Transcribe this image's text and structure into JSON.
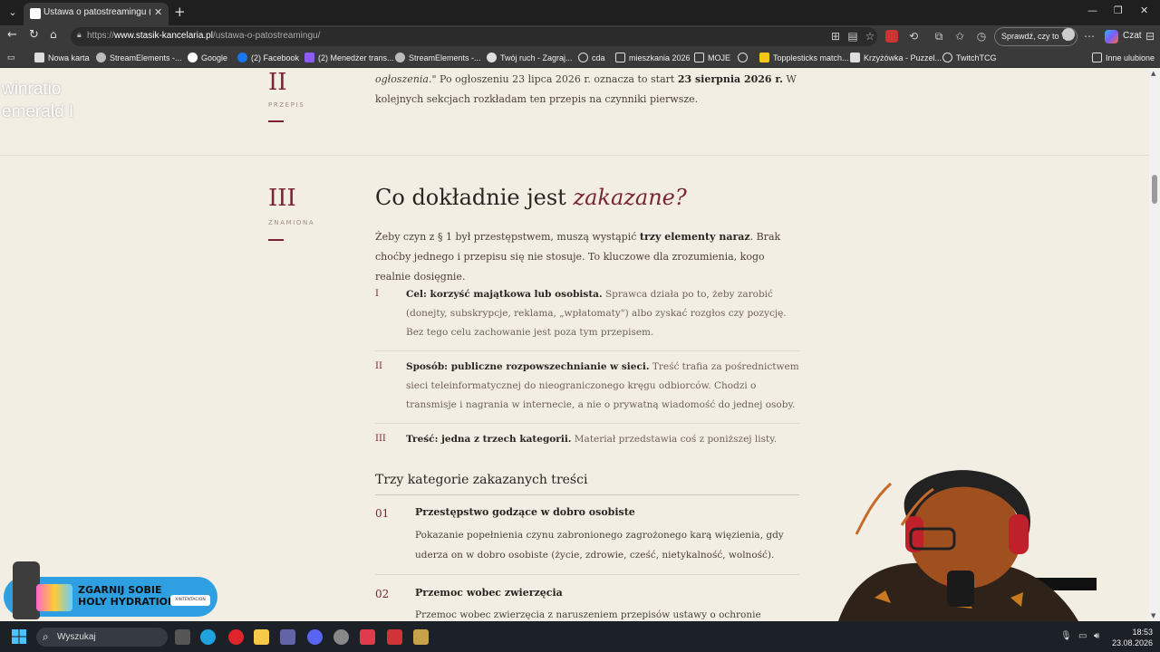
{
  "browser": {
    "tab_title": "Ustawa o patostreamingu (art. 25",
    "url_prefix": "https://",
    "url_domain": "www.stasik-kancelaria.pl",
    "url_path": "/ustawa-o-patostreamingu/",
    "check_button": "Sprawdź, czy to Ty",
    "copilot_label": "Czat"
  },
  "bookmarks": [
    "Nowa karta",
    "StreamElements -...",
    "Google",
    "(2) Facebook",
    "(2) Menedżer trans...",
    "StreamElements -...",
    "Twój ruch - Zagraj...",
    "cda",
    "mieszkania 2026",
    "MOJE",
    "",
    "Topplesticks match...",
    "Krzyżówka - Puzzel...",
    "TwitchTCG"
  ],
  "bookmarks_other": "Inne ulubione",
  "overlay_text": "winratio\nemerald I",
  "section2": {
    "numeral": "II",
    "label": "PRZEPIS",
    "para_em": "ogłoszenia.\"",
    "para_a": " Po ogłoszeniu 23 lipca 2026 r. oznacza to start ",
    "para_b": "23 sierpnia 2026 r.",
    "para_c": " W kolejnych sekcjach rozkładam ten przepis na czynniki pierwsze."
  },
  "section3": {
    "numeral": "III",
    "label": "ZNAMIONA",
    "heading_a": "Co dokładnie jest ",
    "heading_em": "zakazane?",
    "intro_a": "Żeby czyn z § 1 był przestępstwem, muszą wystąpić ",
    "intro_b": "trzy elementy naraz",
    "intro_c": ". Brak choćby jednego i przepisu się nie stosuje. To kluczowe dla zrozumienia, kogo realnie dosięgnie.",
    "requirements": [
      {
        "num": "I",
        "title": "Cel: korzyść majątkowa lub osobista.",
        "text": " Sprawca działa po to, żeby zarobić (donejty, subskrypcje, reklama, „wpłatomaty\") albo zyskać rozgłos czy pozycję. Bez tego celu zachowanie jest poza tym przepisem."
      },
      {
        "num": "II",
        "title": "Sposób: publiczne rozpowszechnianie w sieci.",
        "text": " Treść trafia za pośrednictwem sieci teleinformatycznej do nieograniczonego kręgu odbiorców. Chodzi o transmisje i nagrania w internecie, a nie o prywatną wiadomość do jednej osoby."
      },
      {
        "num": "III",
        "title": "Treść: jedna z trzech kategorii.",
        "text": " Materiał przedstawia coś z poniższej listy."
      }
    ],
    "categories_heading": "Trzy kategorie zakazanych treści",
    "categories": [
      {
        "num": "01",
        "title": "Przestępstwo godzące w dobro osobiste",
        "text": "Pokazanie popełnienia czynu zabronionego zagrożonego karą więzienia, gdy uderza on w dobro osobiste (życie, zdrowie, cześć, nietykalność, wolność)."
      },
      {
        "num": "02",
        "title": "Przemoc wobec zwierzęcia",
        "text": "Przemoc wobec zwierzęcia z naruszeniem przepisów ustawy o ochronie zwierząt."
      }
    ]
  },
  "promo": {
    "text": "ZGARNIJ SOBIE\nHOLY HYDRATION",
    "badge": "XINTENTACION"
  },
  "taskbar": {
    "search_label": "Wyszukaj",
    "time": "18:53",
    "date": "23.08.2026"
  }
}
